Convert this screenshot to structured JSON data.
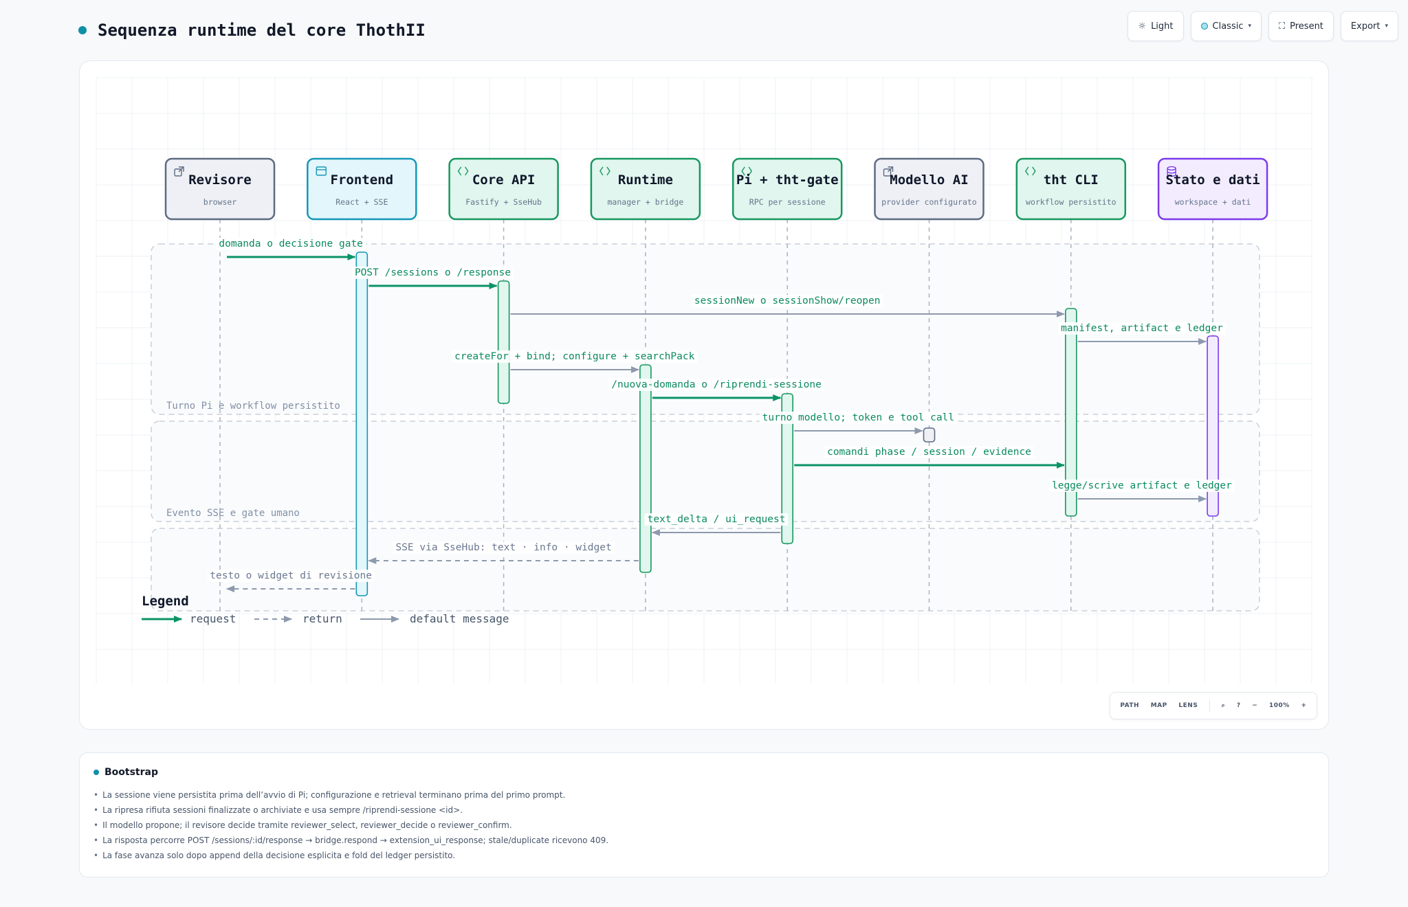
{
  "header": {
    "title": "Sequenza runtime del core ThothII"
  },
  "toolbar": {
    "theme_label": "Light",
    "style_label": "Classic",
    "present_label": "Present",
    "export_label": "Export"
  },
  "participants": [
    {
      "title": "Revisore",
      "subtitle": "browser",
      "kind": "external",
      "icon": "external-link-icon",
      "fill": "#eef0f5",
      "stroke": "#5d6b82",
      "bar": "#5d6b82"
    },
    {
      "title": "Frontend",
      "subtitle": "React + SSE",
      "kind": "ui",
      "icon": "window-icon",
      "fill": "#e3f6fb",
      "stroke": "#1597b8",
      "bar": "#1597b8"
    },
    {
      "title": "Core API",
      "subtitle": "Fastify + SseHub",
      "kind": "service",
      "icon": "code-icon",
      "fill": "#e0f6ee",
      "stroke": "#17975f",
      "bar": "#17975f"
    },
    {
      "title": "Runtime",
      "subtitle": "manager + bridge",
      "kind": "service",
      "icon": "code-icon",
      "fill": "#e0f6ee",
      "stroke": "#17975f",
      "bar": "#17975f"
    },
    {
      "title": "Pi + tht-gate",
      "subtitle": "RPC per sessione",
      "kind": "service",
      "icon": "code-icon",
      "fill": "#e0f6ee",
      "stroke": "#17975f",
      "bar": "#17975f"
    },
    {
      "title": "Modello AI",
      "subtitle": "provider configurato",
      "kind": "external",
      "icon": "external-link-icon",
      "fill": "#eef0f5",
      "stroke": "#5d6b82",
      "bar": "#5d6b82"
    },
    {
      "title": "tht CLI",
      "subtitle": "workflow persistito",
      "kind": "service",
      "icon": "code-icon",
      "fill": "#e0f6ee",
      "stroke": "#17975f",
      "bar": "#17975f"
    },
    {
      "title": "Stato e dati",
      "subtitle": "workspace + dati",
      "kind": "storage",
      "icon": "database-icon",
      "fill": "#f3ecfe",
      "stroke": "#7c3aed",
      "bar": "#7c3aed"
    }
  ],
  "groups": [
    {
      "label": "Turno Pi e workflow persistito"
    },
    {
      "label": "Evento SSE e gate umano"
    },
    {
      "label": ""
    }
  ],
  "messages": [
    {
      "from": 0,
      "to": 1,
      "label": "domanda o decisione gate",
      "type": "request"
    },
    {
      "from": 1,
      "to": 2,
      "label": "POST /sessions o /response",
      "type": "request"
    },
    {
      "from": 2,
      "to": 6,
      "label": "sessionNew o sessionShow/reopen",
      "type": "default"
    },
    {
      "from": 6,
      "to": 7,
      "label": "manifest, artifact e ledger",
      "type": "default"
    },
    {
      "from": 2,
      "to": 3,
      "label": "createFor + bind; configure + searchPack",
      "type": "default"
    },
    {
      "from": 3,
      "to": 4,
      "label": "/nuova-domanda o /riprendi-sessione",
      "type": "request"
    },
    {
      "from": 4,
      "to": 5,
      "label": "turno modello; token e tool call",
      "type": "default"
    },
    {
      "from": 4,
      "to": 6,
      "label": "comandi phase / session / evidence",
      "type": "request"
    },
    {
      "from": 6,
      "to": 7,
      "label": "legge/scrive artifact e ledger",
      "type": "default"
    },
    {
      "from": 4,
      "to": 3,
      "label": "text_delta / ui_request",
      "type": "default"
    },
    {
      "from": 3,
      "to": 1,
      "label": "SSE via SseHub: text · info · widget",
      "type": "return"
    },
    {
      "from": 1,
      "to": 0,
      "label": "testo o widget di revisione",
      "type": "return"
    }
  ],
  "legend": {
    "title": "Legend",
    "request": "request",
    "return": "return",
    "default": "default message"
  },
  "colors": {
    "request": "#0a9466",
    "default": "#8d99ad",
    "lifeline": "#a9b2c0",
    "group_border": "#c9d0da",
    "grid": "#eef1f5"
  },
  "zoom": {
    "path_label": "PATH",
    "map_label": "MAP",
    "lens_label": "LENS",
    "minus_label": "−",
    "level": "100%",
    "plus_label": "+"
  },
  "notes": {
    "title": "Bootstrap",
    "items": [
      "La sessione viene persistita prima dell’avvio di Pi; configurazione e retrieval terminano prima del primo prompt.",
      "La ripresa rifiuta sessioni finalizzate o archiviate e usa sempre /riprendi-sessione <id>.",
      "Il modello propone; il revisore decide tramite reviewer_select, reviewer_decide o reviewer_confirm.",
      "La risposta percorre POST /sessions/:id/response → bridge.respond → extension_ui_response; stale/duplicate ricevono 409.",
      "La fase avanza solo dopo append della decisione esplicita e fold del ledger persistito."
    ]
  }
}
